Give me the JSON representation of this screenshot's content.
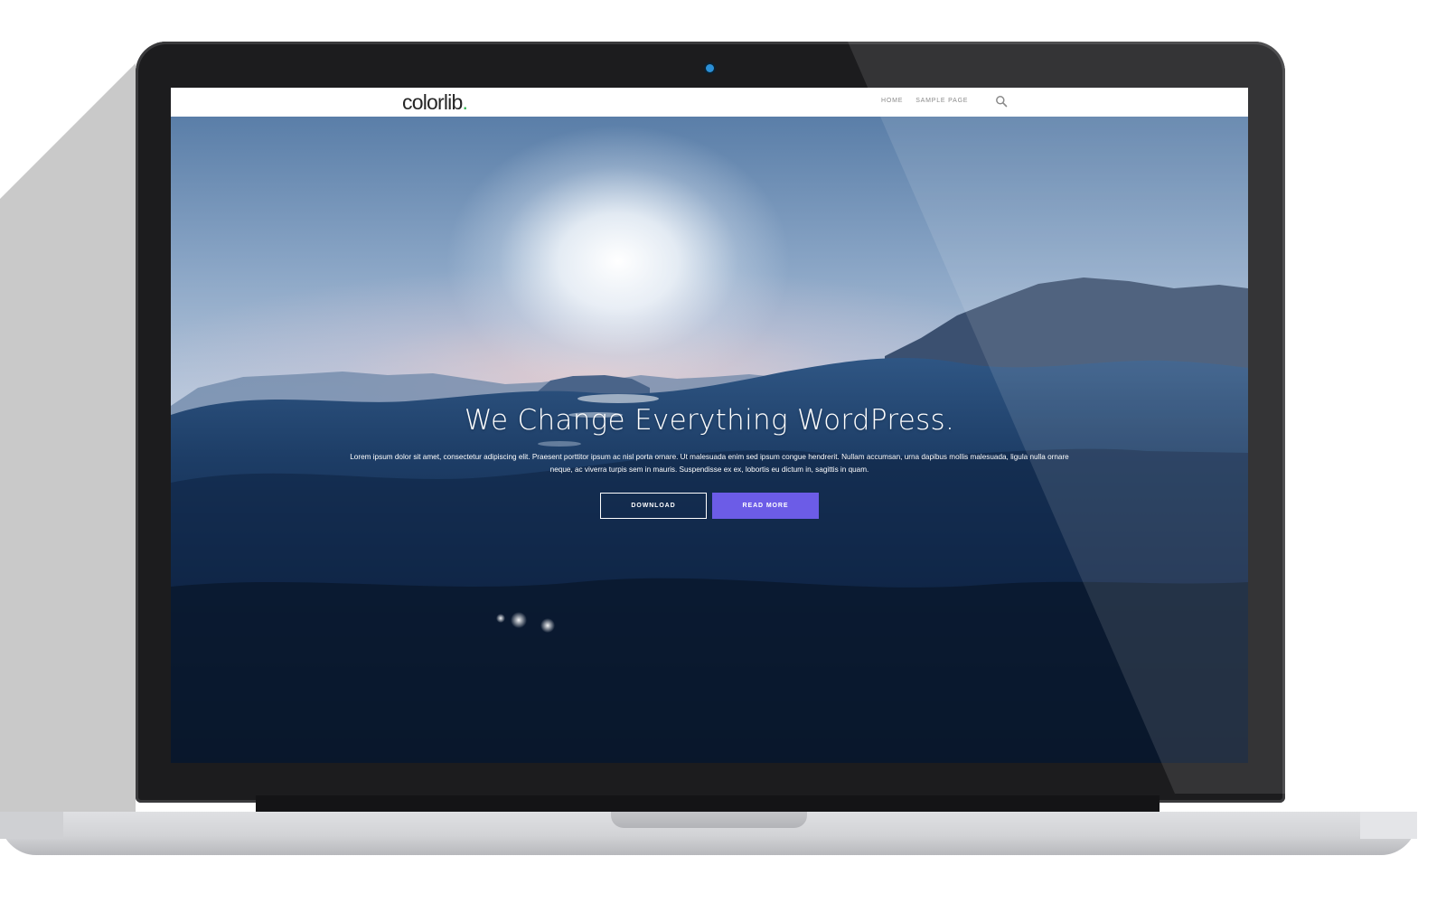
{
  "site": {
    "logo_text": "colorlib",
    "logo_dot": ".",
    "nav_items": [
      "HOME",
      "SAMPLE PAGE"
    ],
    "search_icon": "search-icon"
  },
  "hero": {
    "title": "We Change Everything WordPress.",
    "text": "Lorem ipsum dolor sit amet, consectetur adipiscing elit. Praesent porttitor ipsum ac nisl porta ornare. Ut malesuada enim sed ipsum congue hendrerit. Nullam accumsan, urna dapibus mollis malesuada, ligula nulla ornare neque, ac viverra turpis sem in mauris. Suspendisse ex ex, lobortis eu dictum in, sagittis in quam.",
    "buttons": {
      "download": "DOWNLOAD",
      "read_more": "READ MORE"
    }
  },
  "colors": {
    "accent": "#6c5ce7",
    "logo_dot": "#2bb24c",
    "laptop_bezel": "#1c1c1e"
  }
}
